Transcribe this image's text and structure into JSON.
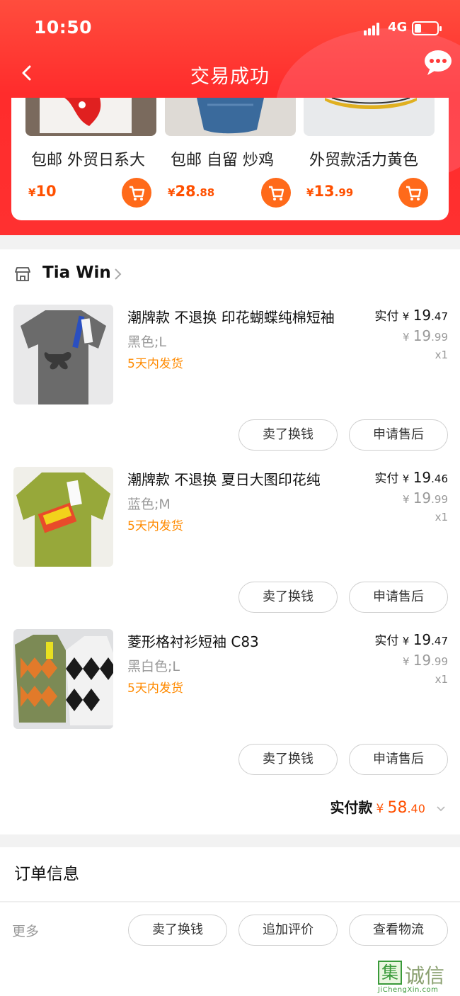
{
  "status_bar": {
    "time": "10:50",
    "network": "4G"
  },
  "header": {
    "title": "交易成功"
  },
  "recommend": [
    {
      "title": "包邮 外贸日系大",
      "price_symbol": "¥",
      "price_int": "10",
      "price_dec": ""
    },
    {
      "title": "包邮 自留  炒鸡",
      "price_symbol": "¥",
      "price_int": "28",
      "price_dec": ".88"
    },
    {
      "title": "外贸款活力黄色",
      "price_symbol": "¥",
      "price_int": "13",
      "price_dec": ".99"
    }
  ],
  "shop": {
    "name": "Tia Win",
    "items": [
      {
        "title": "潮牌款 不退换 印花蝴蝶纯棉短袖",
        "sku": "黑色;L",
        "shipping": "5天内发货",
        "paid_label": "实付",
        "paid_symbol": "¥",
        "paid_int": "19",
        "paid_dec": ".47",
        "orig_symbol": "¥",
        "orig_int": "19",
        "orig_dec": ".99",
        "qty": "x1",
        "button_sell": "卖了换钱",
        "button_aftersale": "申请售后"
      },
      {
        "title": "潮牌款  不退换  夏日大图印花纯",
        "sku": "蓝色;M",
        "shipping": "5天内发货",
        "paid_label": "实付",
        "paid_symbol": "¥",
        "paid_int": "19",
        "paid_dec": ".46",
        "orig_symbol": "¥",
        "orig_int": "19",
        "orig_dec": ".99",
        "qty": "x1",
        "button_sell": "卖了换钱",
        "button_aftersale": "申请售后"
      },
      {
        "title": "菱形格衬衫短袖 C83",
        "sku": "黑白色;L",
        "shipping": "5天内发货",
        "paid_label": "实付",
        "paid_symbol": "¥",
        "paid_int": "19",
        "paid_dec": ".47",
        "orig_symbol": "¥",
        "orig_int": "19",
        "orig_dec": ".99",
        "qty": "x1",
        "button_sell": "卖了换钱",
        "button_aftersale": "申请售后"
      }
    ],
    "total_label": "实付款",
    "total_symbol": "¥",
    "total_int": "58",
    "total_dec": ".40"
  },
  "order_info": {
    "title": "订单信息"
  },
  "bottom_bar": {
    "more_label": "更多",
    "sell_button": "卖了换钱",
    "review_button": "追加评价",
    "logistics_button": "查看物流"
  },
  "watermark": {
    "box_char": "集",
    "text": "诚信",
    "sub": "JiChengXin.com"
  },
  "colors": {
    "brand_red": "#ff3030",
    "price_orange": "#ff5000",
    "ship_orange": "#ff8a00"
  }
}
